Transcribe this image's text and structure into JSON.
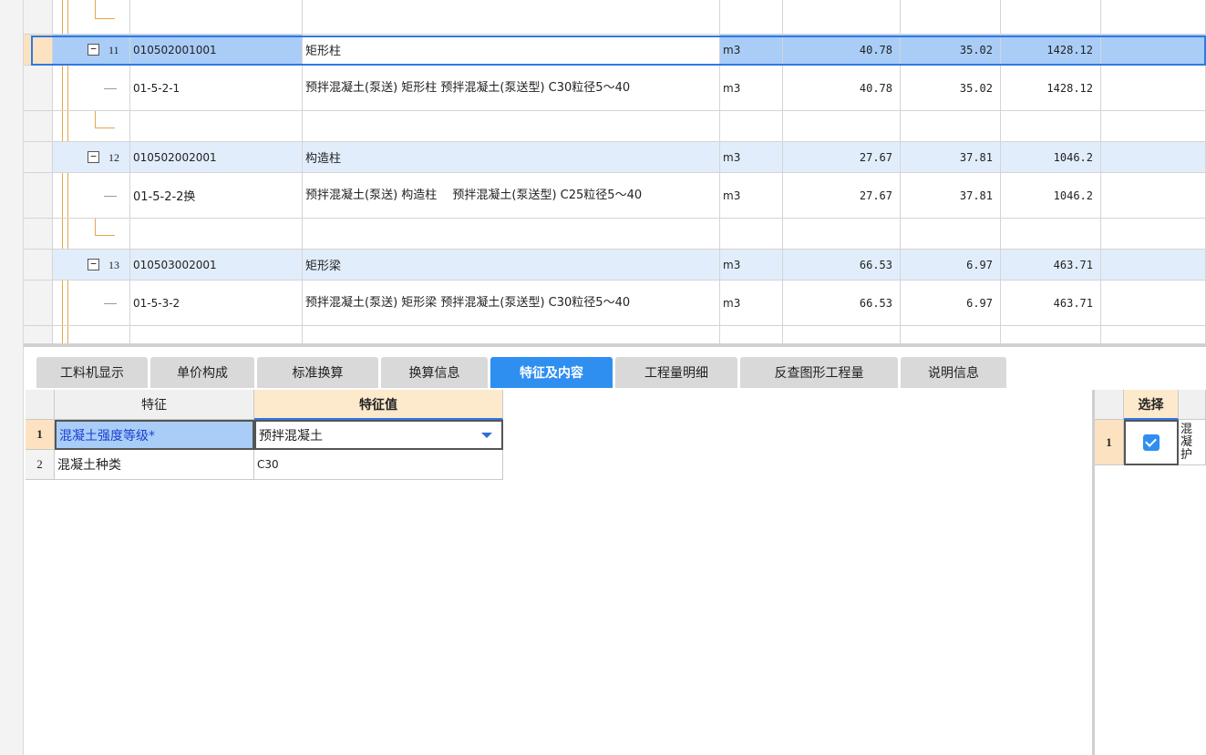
{
  "grid": {
    "rows": [
      {
        "kind": "list",
        "index": "11",
        "code": "010502001001",
        "name": "矩形柱",
        "unit": "m3",
        "qty": "40.78",
        "price": "35.02",
        "total": "1428.12",
        "selected": true
      },
      {
        "kind": "quota",
        "code": "01-5-2-1",
        "name": "预拌混凝土(泵送) 矩形柱 预拌混凝土(泵送型) C30粒径5～40",
        "unit": "m3",
        "qty": "40.78",
        "price": "35.02",
        "total": "1428.12"
      },
      {
        "kind": "list",
        "index": "12",
        "code": "010502002001",
        "name": "构造柱",
        "unit": "m3",
        "qty": "27.67",
        "price": "37.81",
        "total": "1046.2"
      },
      {
        "kind": "quota",
        "code": "01-5-2-2换",
        "name": "预拌混凝土(泵送) 构造柱　 预拌混凝土(泵送型) C25粒径5～40",
        "unit": "m3",
        "qty": "27.67",
        "price": "37.81",
        "total": "1046.2"
      },
      {
        "kind": "list",
        "index": "13",
        "code": "010503002001",
        "name": "矩形梁",
        "unit": "m3",
        "qty": "66.53",
        "price": "6.97",
        "total": "463.71"
      },
      {
        "kind": "quota",
        "code": "01-5-3-2",
        "name": "预拌混凝土(泵送) 矩形梁 预拌混凝土(泵送型) C30粒径5～40",
        "unit": "m3",
        "qty": "66.53",
        "price": "6.97",
        "total": "463.71"
      }
    ]
  },
  "tabs": [
    {
      "label": "工料机显示"
    },
    {
      "label": "单价构成"
    },
    {
      "label": "标准换算"
    },
    {
      "label": "换算信息"
    },
    {
      "label": "特征及内容",
      "active": true
    },
    {
      "label": "工程量明细"
    },
    {
      "label": "反查图形工程量"
    },
    {
      "label": "说明信息"
    }
  ],
  "features": {
    "header": {
      "name": "特征",
      "value": "特征值"
    },
    "rows": [
      {
        "num": "1",
        "name": "混凝土强度等级*",
        "value": "预拌混凝土",
        "selected": true
      },
      {
        "num": "2",
        "name": "混凝土种类",
        "value": "C30"
      }
    ]
  },
  "content_panel": {
    "header_select": "选择",
    "rows": [
      {
        "num": "1",
        "checked": true,
        "text": "混凝护"
      }
    ]
  },
  "colors": {
    "accent": "#2f8ff0",
    "selection": "#a9cdf7",
    "list_row": "#e2edfb",
    "tree_line": "#e8a64a"
  }
}
